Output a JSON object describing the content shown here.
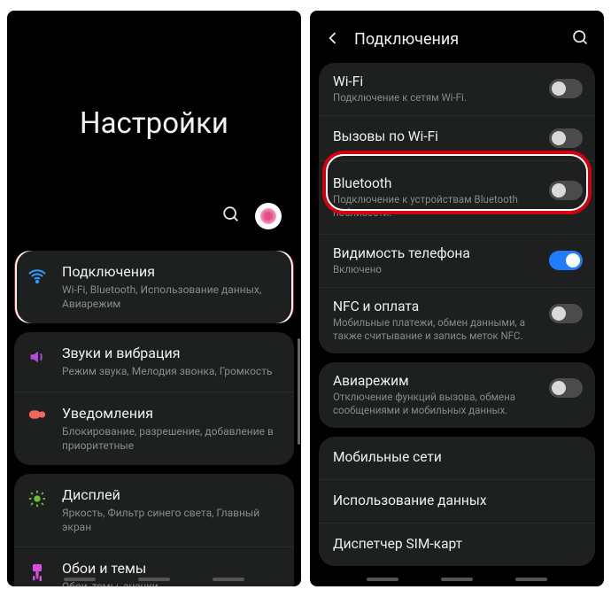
{
  "left": {
    "title": "Настройки",
    "sections": [
      {
        "items": [
          {
            "title": "Подключения",
            "sub": "Wi-Fi, Bluetooth, Использование данных, Авиарежим",
            "highlight": true
          }
        ]
      },
      {
        "items": [
          {
            "title": "Звуки и вибрация",
            "sub": "Режим звука, Мелодия звонка, Громкость"
          },
          {
            "title": "Уведомления",
            "sub": "Блокирование, разрешение, добавление в приоритетные"
          }
        ]
      },
      {
        "items": [
          {
            "title": "Дисплей",
            "sub": "Яркость, Фильтр синего света, Главный экран"
          },
          {
            "title": "Обои и темы",
            "sub": "Обои, темы, значки"
          }
        ]
      }
    ]
  },
  "right": {
    "header": "Подключения",
    "groups": [
      {
        "items": [
          {
            "title": "Wi-Fi",
            "sub": "Подключение к сетям Wi-Fi.",
            "toggle": "off"
          },
          {
            "title": "Вызовы по Wi-Fi",
            "sub": "",
            "toggle": "off"
          },
          {
            "title": "Bluetooth",
            "sub": "Подключение к устройствам Bluetooth поблизости.",
            "toggle": "off",
            "highlight": true
          },
          {
            "title": "Видимость телефона",
            "sub": "Включено",
            "sub_style": "blue",
            "toggle": "on"
          },
          {
            "title": "NFC и оплата",
            "sub": "Мобильные платежи, обмен данными, а также считывание и запись меток NFC.",
            "toggle": "off"
          }
        ]
      },
      {
        "items": [
          {
            "title": "Авиарежим",
            "sub": "Отключение функций вызова, обмена сообщениями и мобильных данных.",
            "toggle": "off"
          }
        ]
      },
      {
        "items": [
          {
            "title": "Мобильные сети",
            "sub": ""
          },
          {
            "title": "Использование данных",
            "sub": ""
          },
          {
            "title": "Диспетчер SIM-карт",
            "sub": ""
          }
        ]
      }
    ]
  }
}
